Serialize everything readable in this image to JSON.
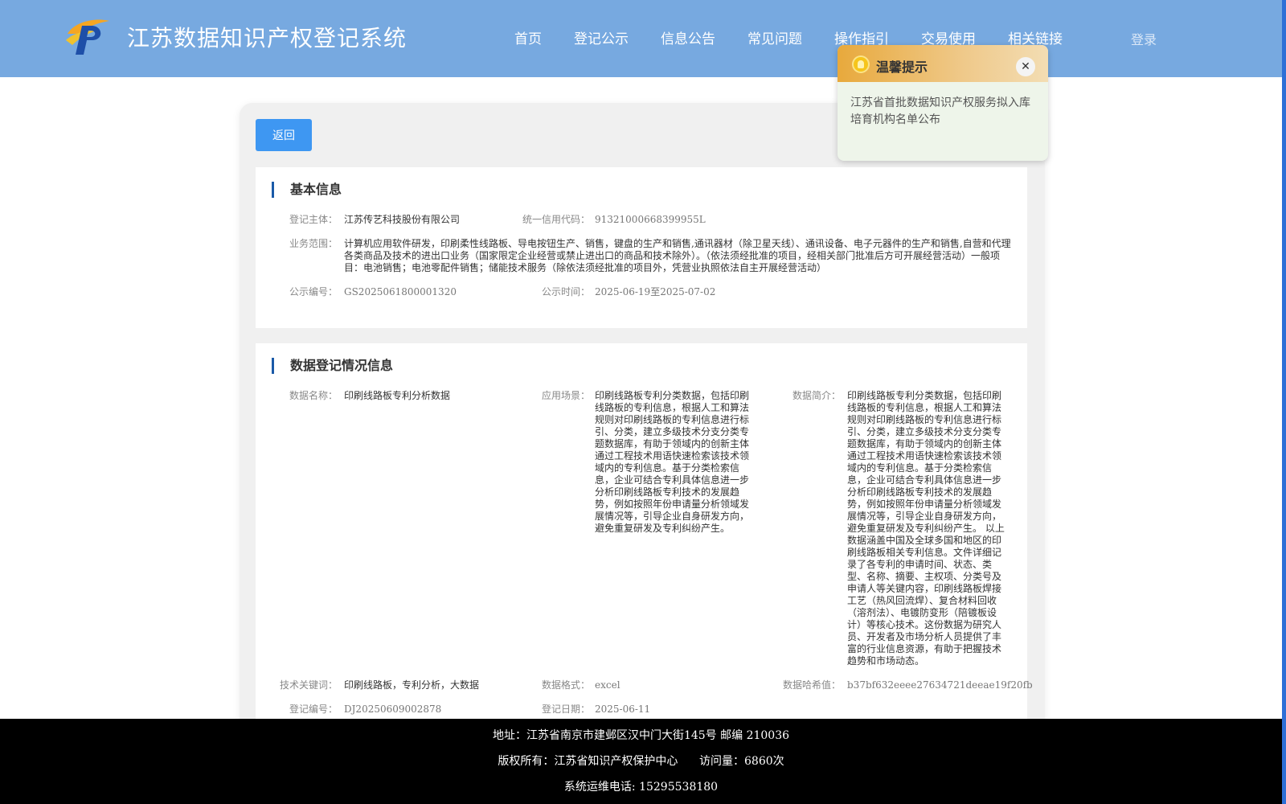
{
  "header": {
    "site_title": "江苏数据知识产权登记系统",
    "nav": [
      "首页",
      "登记公示",
      "信息公告",
      "常见问题",
      "操作指引",
      "交易使用",
      "相关链接"
    ],
    "login": "登录"
  },
  "back_label": "返回",
  "basic_info": {
    "title": "基本信息",
    "subject_label": "登记主体：",
    "subject": "江苏传艺科技股份有限公司",
    "credit_label": "统一信用代码：",
    "credit": "91321000668399955L",
    "scope_label": "业务范围：",
    "scope": "计算机应用软件研发，印刷柔性线路板、导电按钮生产、销售，键盘的生产和销售,通讯器材（除卫星天线）、通讯设备、电子元器件的生产和销售,自营和代理各类商品及技术的进出口业务（国家限定企业经营或禁止进出口的商品和技术除外）。（依法须经批准的项目，经相关部门批准后方可开展经营活动）一般项目：电池销售；电池零配件销售；储能技术服务（除依法须经批准的项目外，凭营业执照依法自主开展经营活动）",
    "pub_no_label": "公示编号：",
    "pub_no": "GS2025061800001320",
    "pub_time_label": "公示时间：",
    "pub_time": "2025-06-19至2025-07-02"
  },
  "data_reg": {
    "title": "数据登记情况信息",
    "name_label": "数据名称：",
    "name": "印刷线路板专利分析数据",
    "scene_label": "应用场景：",
    "scene": "印刷线路板专利分类数据，包括印刷线路板的专利信息，根据人工和算法规则对印刷线路板的专利信息进行标引、分类，建立多级技术分支分类专题数据库，有助于领域内的创新主体通过工程技术用语快速检索该技术领域内的专利信息。基于分类检索信息，企业可结合专利具体信息进一步分析印刷线路板专利技术的发展趋势，例如按照年份申请量分析领域发展情况等，引导企业自身研发方向，避免重复研发及专利纠纷产生。",
    "intro_label": "数据简介：",
    "intro": "印刷线路板专利分类数据，包括印刷线路板的专利信息，根据人工和算法规则对印刷线路板的专利信息进行标引、分类，建立多级技术分支分类专题数据库，有助于领域内的创新主体通过工程技术用语快速检索该技术领域内的专利信息。基于分类检索信息，企业可结合专利具体信息进一步分析印刷线路板专利技术的发展趋势，例如按照年份申请量分析领域发展情况等，引导企业自身研发方向，避免重复研发及专利纠纷产生。 以上数据涵盖中国及全球多国和地区的印刷线路板相关专利信息。文件详细记录了各专利的申请时间、状态、类型、名称、摘要、主权项、分类号及申请人等关键内容，印刷线路板焊接工艺（热风回流焊）、复合材料回收（溶剂法）、电镀防变形（陪镀板设计）等核心技术。这份数据为研究人员、开发者及市场分析人员提供了丰富的行业信息资源，有助于把握技术趋势和市场动态。",
    "keywords_label": "技术关键词：",
    "keywords": "印刷线路板，专利分析，大数据",
    "format_label": "数据格式：",
    "format": "excel",
    "hash_label": "数据哈希值：",
    "hash": "b37bf632eeee27634721deeae19f20fb",
    "reg_no_label": "登记编号：",
    "reg_no": "DJ20250609002878",
    "reg_date_label": "登记日期：",
    "reg_date": "2025-06-11"
  },
  "popup": {
    "title": "温馨提示",
    "close": "✕",
    "body": "江苏省首批数据知识产权服务拟入库培育机构名单公布"
  },
  "footer": {
    "address": "地址：江苏省南京市建邺区汉中门大街145号 邮编 210036",
    "copyright": "版权所有：江苏省知识产权保护中心      访问量：6860次",
    "phone": "系统运维电话: 15295538180"
  },
  "colors": {
    "header_bg": "#77a9e0",
    "accent": "#3e97f2",
    "footer_bg": "#000000"
  }
}
